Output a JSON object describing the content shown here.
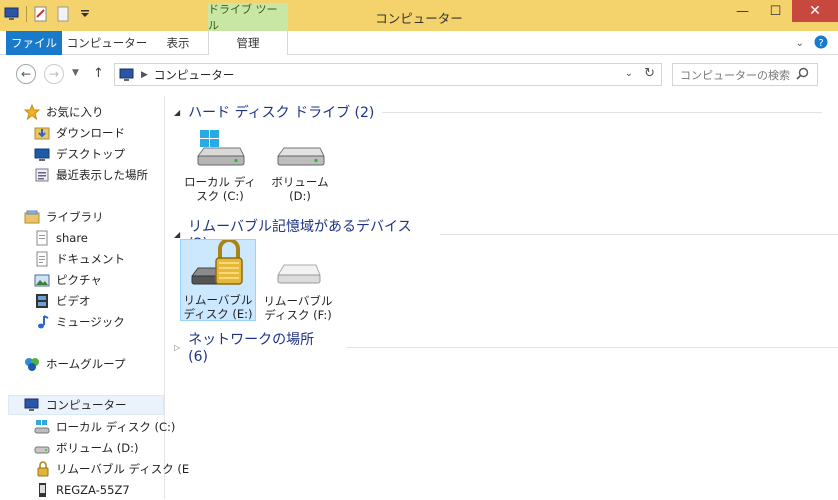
{
  "window": {
    "title": "コンピューター",
    "context_tab": "ドライブ ツール"
  },
  "ribbon": {
    "tabs": [
      "ファイル",
      "コンピューター",
      "表示",
      "管理"
    ]
  },
  "address": {
    "path": "コンピューター",
    "search_placeholder": "コンピューターの検索"
  },
  "nav": {
    "favorites_header": "お気に入り",
    "favorites": [
      "ダウンロード",
      "デスクトップ",
      "最近表示した場所"
    ],
    "libraries_header": "ライブラリ",
    "libraries": [
      "share",
      "ドキュメント",
      "ピクチャ",
      "ビデオ",
      "ミュージック"
    ],
    "homegroup": "ホームグループ",
    "computer_header": "コンピューター",
    "computer_items": [
      "ローカル ディスク (C:)",
      "ボリューム (D:)",
      "リムーバブル ディスク (E",
      "REGZA-55Z7"
    ]
  },
  "groups": {
    "hdd": {
      "title": "ハード ディスク ドライブ (2)",
      "items": [
        [
          "ローカル ディ",
          "スク (C:)"
        ],
        [
          "ボリューム",
          "(D:)"
        ]
      ]
    },
    "removable": {
      "title": "リムーバブル記憶域があるデバイス (2)",
      "items": [
        [
          "リムーバブル",
          "ディスク (E:)"
        ],
        [
          "リムーバブル",
          "ディスク (F:)"
        ]
      ]
    },
    "network": {
      "title": "ネットワークの場所 (6)"
    }
  },
  "colors": {
    "accent": "#1979ca",
    "titlebar": "#f4d36c",
    "context": "#c8e6a4",
    "group_header": "#1e3287",
    "close": "#c7483f"
  }
}
